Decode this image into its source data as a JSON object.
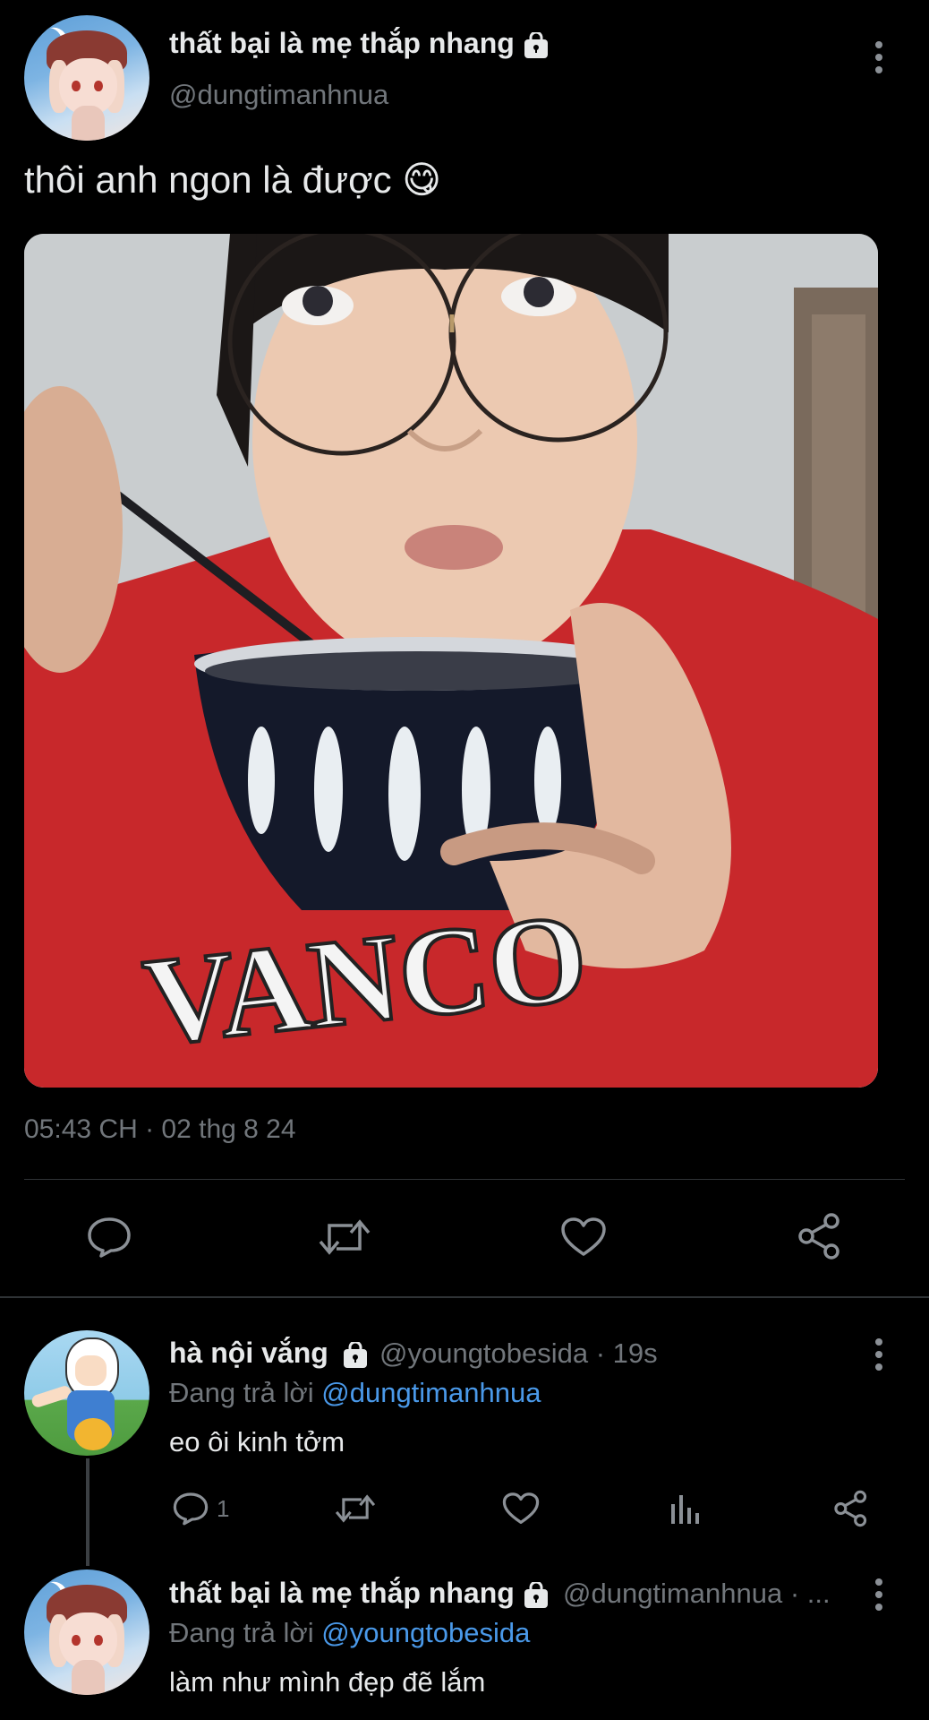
{
  "main_tweet": {
    "display_name": "thất bại là mẹ thắp nhang",
    "handle": "@dungtimanhnua",
    "text": "thôi anh ngon là được 😋",
    "emoji_icon": "face-savoring-food-emoji",
    "photo_caption_text": "VANCO",
    "timestamp": "05:43 CH · 02 thg 8 24",
    "actions": [
      "reply-icon",
      "retweet-icon",
      "like-icon",
      "share-icon"
    ]
  },
  "replies": [
    {
      "display_name": "hà nội vắng",
      "handle_meta": "@youngtobesida · 19s",
      "replying_prefix": "Đang trả lời",
      "replying_to": "@dungtimanhnua",
      "text": "eo ôi kinh tởm",
      "reply_count": "1"
    },
    {
      "display_name": "thất bại là mẹ thắp nhang",
      "handle_meta": "@dungtimanhnua · ...",
      "replying_prefix": "Đang trả lời",
      "replying_to": "@youngtobesida",
      "text": "làm như mình đẹp đẽ lắm"
    }
  ],
  "colors": {
    "background": "#000000",
    "text": "#e7e9ea",
    "muted": "#71767b",
    "link": "#4a99e9",
    "divider": "#2f3336"
  }
}
